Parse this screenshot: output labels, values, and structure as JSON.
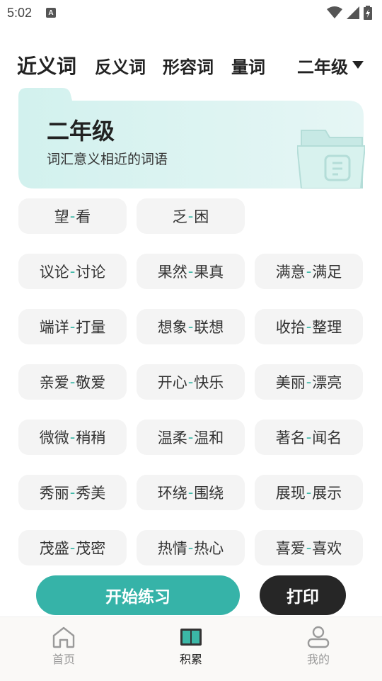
{
  "status_bar": {
    "time": "5:02",
    "notification_letter": "A"
  },
  "tabs": [
    {
      "label": "近义词",
      "active": true
    },
    {
      "label": "反义词",
      "active": false
    },
    {
      "label": "形容词",
      "active": false
    },
    {
      "label": "量词",
      "active": false
    }
  ],
  "grade_select": {
    "value": "二年级"
  },
  "banner": {
    "title": "二年级",
    "subtitle": "词汇意义相近的词语",
    "icon": "folder-icon"
  },
  "pairs": [
    {
      "a": "望",
      "b": "看"
    },
    {
      "a": "乏",
      "b": "困"
    },
    {
      "a": "议论",
      "b": "讨论"
    },
    {
      "a": "果然",
      "b": "果真"
    },
    {
      "a": "满意",
      "b": "满足"
    },
    {
      "a": "端详",
      "b": "打量"
    },
    {
      "a": "想象",
      "b": "联想"
    },
    {
      "a": "收拾",
      "b": "整理"
    },
    {
      "a": "亲爱",
      "b": "敬爱"
    },
    {
      "a": "开心",
      "b": "快乐"
    },
    {
      "a": "美丽",
      "b": "漂亮"
    },
    {
      "a": "微微",
      "b": "稍稍"
    },
    {
      "a": "温柔",
      "b": "温和"
    },
    {
      "a": "著名",
      "b": "闻名"
    },
    {
      "a": "秀丽",
      "b": "秀美"
    },
    {
      "a": "环绕",
      "b": "围绕"
    },
    {
      "a": "展现",
      "b": "展示"
    },
    {
      "a": "茂盛",
      "b": "茂密"
    },
    {
      "a": "热情",
      "b": "热心"
    },
    {
      "a": "喜爱",
      "b": "喜欢"
    }
  ],
  "buttons": {
    "start": "开始练习",
    "print": "打印"
  },
  "bottom_nav": [
    {
      "label": "首页",
      "icon": "home-icon",
      "active": false
    },
    {
      "label": "积累",
      "icon": "book-icon",
      "active": true
    },
    {
      "label": "我的",
      "icon": "profile-icon",
      "active": false
    }
  ],
  "colors": {
    "accent": "#36b3a8",
    "dash": "#3bb7a6",
    "dark_button": "#262626",
    "banner_bg": "#d7f3f1"
  }
}
